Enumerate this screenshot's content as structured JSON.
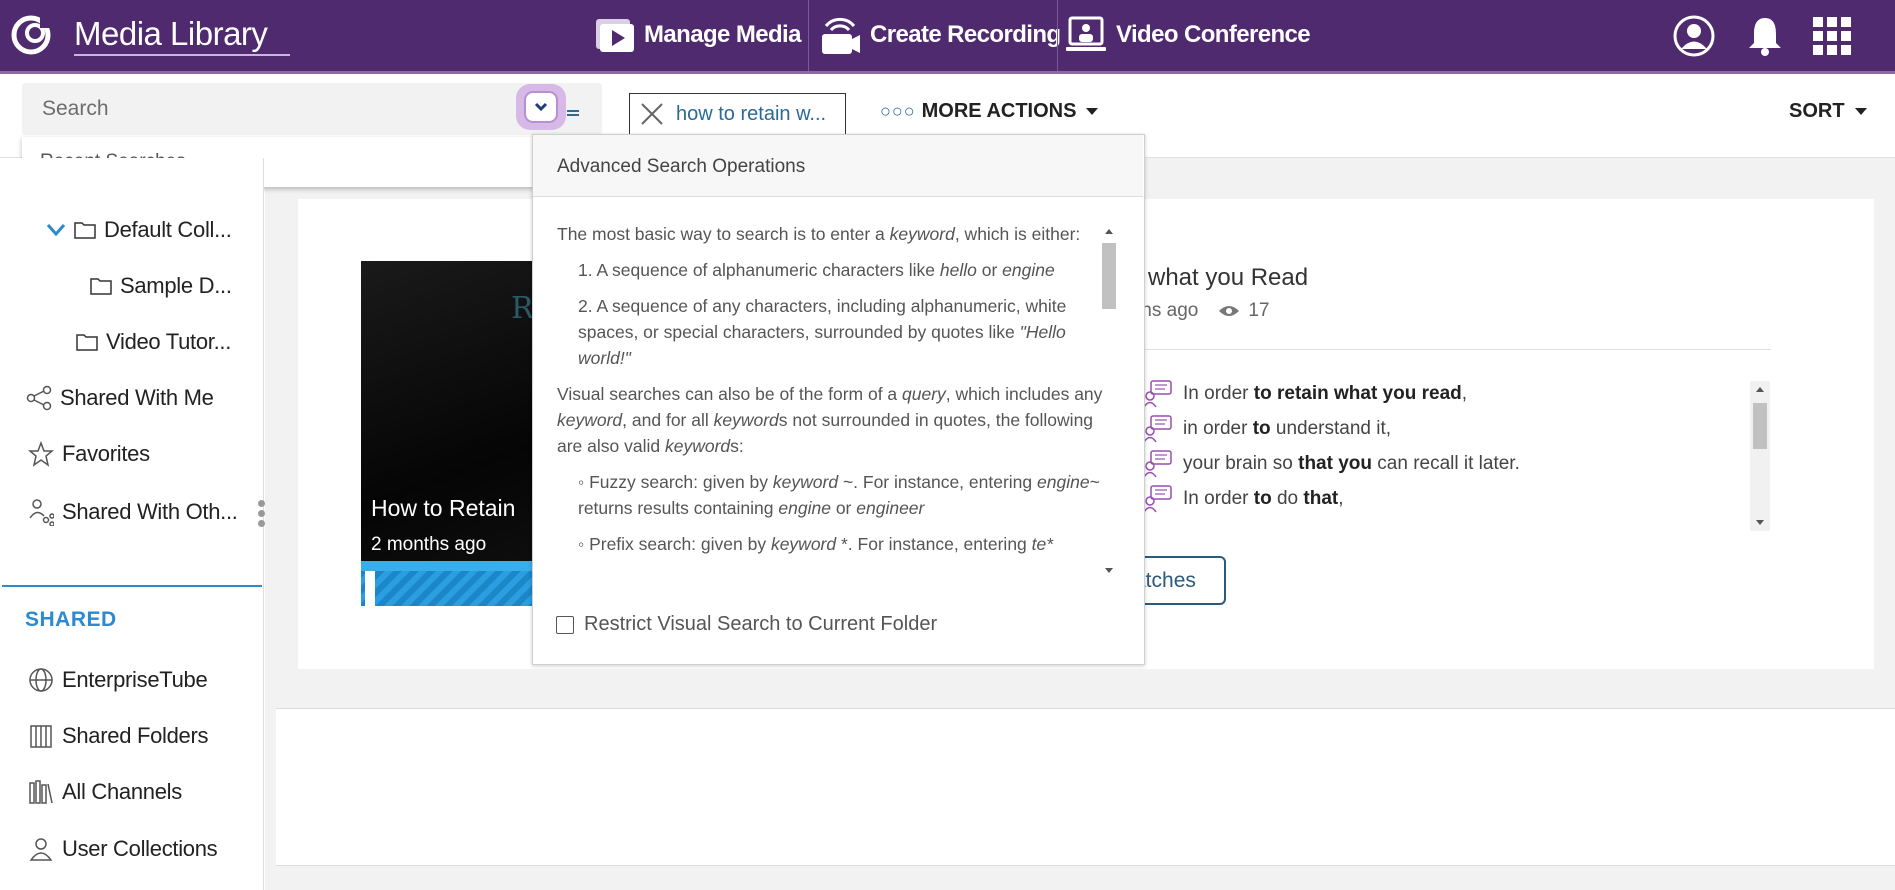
{
  "header": {
    "app_title": "Media Library",
    "nav": [
      {
        "label": "Manage Media",
        "icon": "manage-media-icon"
      },
      {
        "label": "Create Recording",
        "icon": "create-recording-icon"
      },
      {
        "label": "Video Conference",
        "icon": "video-conference-icon"
      }
    ],
    "right_icons": [
      "user-icon",
      "bell-icon",
      "apps-grid-icon"
    ],
    "bar_color": "#4f2a6e"
  },
  "toolbar": {
    "search": {
      "placeholder": "Search",
      "value": ""
    },
    "recent_searches_label": "Recent Searches",
    "filter_chip": "how to retain w...",
    "more_actions_label": "MORE ACTIONS",
    "sort_label": "SORT"
  },
  "sidebar": {
    "tree": [
      {
        "label": "Default Coll...",
        "icon": "folder-icon"
      },
      {
        "label": "Sample D...",
        "icon": "folder-icon"
      },
      {
        "label": "Video Tutor...",
        "icon": "folder-icon"
      }
    ],
    "items": [
      {
        "label": "Shared With Me",
        "icon": "share-icon"
      },
      {
        "label": "Favorites",
        "icon": "star-icon"
      },
      {
        "label": "Shared With Oth...",
        "icon": "shared-users-icon"
      }
    ],
    "shared_heading": "SHARED",
    "shared_items": [
      {
        "label": "EnterpriseTube",
        "icon": "globe-icon"
      },
      {
        "label": "Shared Folders",
        "icon": "shared-folders-icon"
      },
      {
        "label": "All Channels",
        "icon": "channels-icon"
      },
      {
        "label": "User Collections",
        "icon": "user-collections-icon"
      }
    ],
    "accent_color": "#2b8ad0"
  },
  "media": {
    "thumb_title": "How to Retain",
    "thumb_date": "2 months ago",
    "thumb_overlay_text": "Re",
    "title": "what you Read",
    "age": "ths ago",
    "views": "17",
    "matches_label": "atches"
  },
  "transcript": [
    [
      {
        "t": "In order ",
        "b": false
      },
      {
        "t": "to retain what you read",
        "b": true
      },
      {
        "t": ",",
        "b": false
      }
    ],
    [
      {
        "t": "in order ",
        "b": false
      },
      {
        "t": "to",
        "b": true
      },
      {
        "t": " understand it,",
        "b": false
      }
    ],
    [
      {
        "t": "your brain so ",
        "b": false
      },
      {
        "t": "that you",
        "b": true
      },
      {
        "t": " can recall it later.",
        "b": false
      }
    ],
    [
      {
        "t": "In order ",
        "b": false
      },
      {
        "t": "to",
        "b": true
      },
      {
        "t": " do ",
        "b": false
      },
      {
        "t": "that",
        "b": true
      },
      {
        "t": ",",
        "b": false
      }
    ]
  ],
  "advanced_search": {
    "title": "Advanced Search Operations",
    "intro_a": "The most basic way to search is to enter a ",
    "intro_kw": "keyword",
    "intro_b": ", which is either:",
    "item1_a": "1. A sequence of alphanumeric characters like ",
    "item1_k1": "hello",
    "item1_or": " or ",
    "item1_k2": "engine",
    "item2_a": "2. A sequence of any characters, including alphanumeric, white spaces, or special characters, surrounded by quotes like ",
    "item2_k": "\"Hello world!\"",
    "visual_a": "Visual searches can also be of the form of a ",
    "visual_q": "query",
    "visual_b": ", which includes any ",
    "visual_k1": "keyword",
    "visual_c": ", and for all ",
    "visual_k2": "keyword",
    "visual_d": "s not surrounded in quotes, the following are also valid ",
    "visual_k3": "keyword",
    "visual_e": "s:",
    "fuzzy_a": "◦ Fuzzy search: given by ",
    "fuzzy_k": "keyword",
    "fuzzy_b": " ~. For instance, entering ",
    "fuzzy_k2": "engine",
    "fuzzy_c": "~ returns results containing ",
    "fuzzy_k3": "engine",
    "fuzzy_or": " or ",
    "fuzzy_k4": "engineer",
    "prefix_a": "◦ Prefix search: given by ",
    "prefix_k": "keyword",
    "prefix_b": " *. For instance, entering ",
    "prefix_k2": "te*",
    "restrict_label": "Restrict Visual Search to Current Folder",
    "restrict_checked": false
  }
}
